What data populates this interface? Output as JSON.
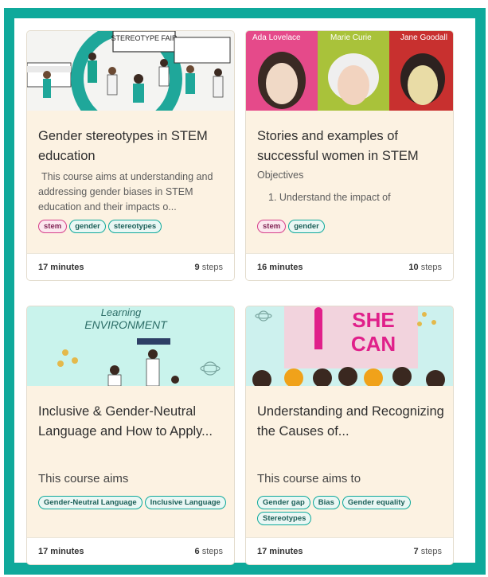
{
  "colors": {
    "frame": "#0fa99b",
    "card_bg": "#fcf2e2",
    "tag_teal": "#0fa99b",
    "tag_pink": "#d63f8a"
  },
  "courses": [
    {
      "title": "Gender stereotypes in STEM education",
      "description": "This course aims at understanding and addressing gender biases in STEM education and their impacts o...",
      "image_text": "STEREOTYPE FAIR",
      "tags": [
        "stem",
        "gender",
        "stereotypes"
      ],
      "duration": "17 minutes",
      "steps_count": "9",
      "steps_label": "steps"
    },
    {
      "title": "Stories and examples of successful women in STEM",
      "description_heading": "Objectives",
      "description_item": "1. Understand the impact of",
      "image_names": [
        "Ada Lovelace",
        "Marie Curie",
        "Jane Goodall"
      ],
      "tags": [
        "stem",
        "gender"
      ],
      "duration": "16 minutes",
      "steps_count": "10",
      "steps_label": "steps"
    },
    {
      "title": "Inclusive & Gender-Neutral Language and How to Apply...",
      "description": "This course aims",
      "image_text": [
        "Learning",
        "ENVIRONMENT"
      ],
      "tags": [
        "Gender-Neutral Language",
        "Inclusive Language"
      ],
      "duration": "17 minutes",
      "steps_count": "6",
      "steps_label": "steps"
    },
    {
      "title": "Understanding and Recognizing the Causes of...",
      "description": "This course aims to",
      "image_text": [
        "SHE",
        "CAN"
      ],
      "tags": [
        "Gender gap",
        "Bias",
        "Gender equality",
        "Stereotypes"
      ],
      "duration": "17 minutes",
      "steps_count": "7",
      "steps_label": "steps"
    }
  ]
}
